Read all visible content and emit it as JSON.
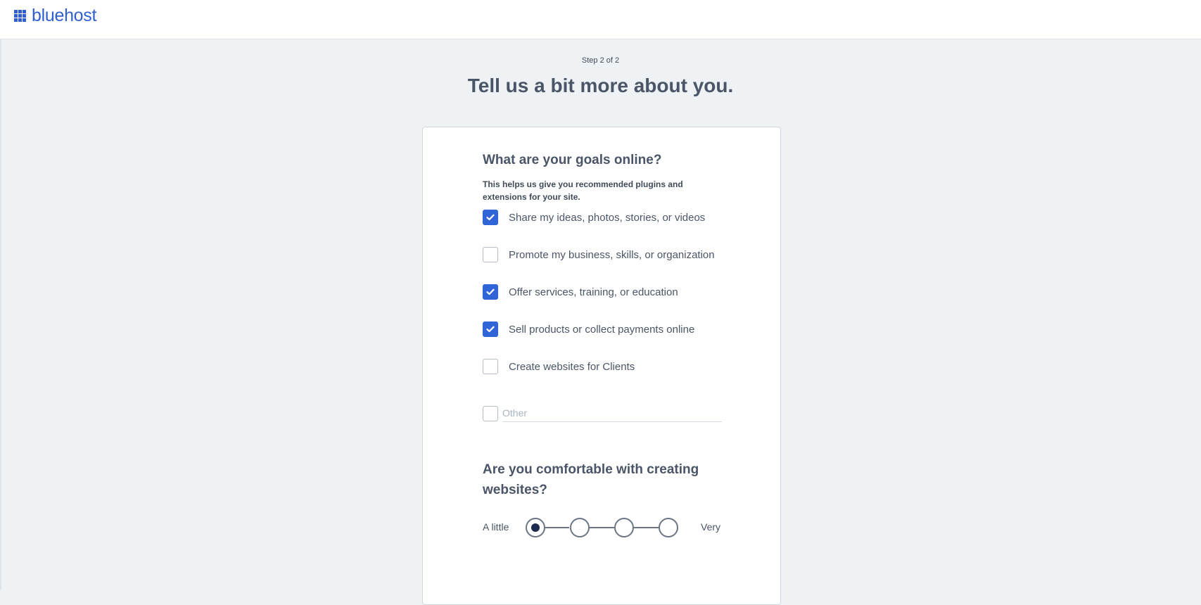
{
  "brand": {
    "name": "bluehost",
    "color": "#2f5fd0"
  },
  "step_label": "Step 2 of 2",
  "page_heading": "Tell us a bit more about you.",
  "goals": {
    "title": "What are your goals online?",
    "subtitle": "This helps us give you recommended plugins and extensions for your site.",
    "options": [
      {
        "label": "Share my ideas, photos, stories, or videos",
        "checked": true
      },
      {
        "label": "Promote my business, skills, or organization",
        "checked": false
      },
      {
        "label": "Offer services, training, or education",
        "checked": true
      },
      {
        "label": "Sell products or collect payments online",
        "checked": true
      },
      {
        "label": "Create websites for Clients",
        "checked": false
      }
    ],
    "other": {
      "checked": false,
      "placeholder": "Other",
      "value": ""
    }
  },
  "comfort": {
    "title": "Are you comfortable with creating websites?",
    "min_label": "A little",
    "max_label": "Very",
    "levels": 4,
    "selected_level": 1
  },
  "colors": {
    "accent": "#2f65d6",
    "selected_dot": "#1b2a4e",
    "background": "#eff2f5"
  }
}
